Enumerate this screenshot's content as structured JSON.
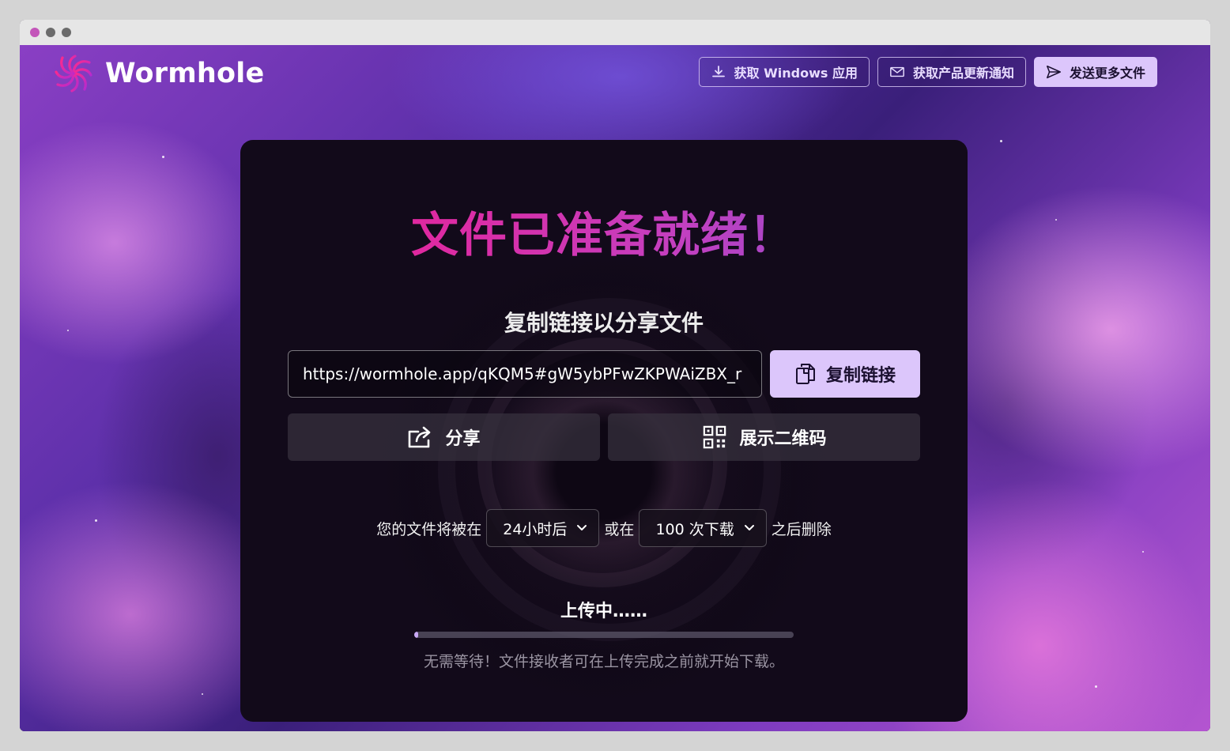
{
  "app": {
    "name": "Wormhole",
    "brand_color": "#f2198a",
    "accent_color": "#dcc6fb"
  },
  "header": {
    "get_windows_app": "获取 Windows 应用",
    "get_updates": "获取产品更新通知",
    "send_more": "发送更多文件",
    "icons": [
      "download-icon",
      "mail-icon",
      "send-icon"
    ]
  },
  "main": {
    "title": "文件已准备就绪！",
    "share_heading": "复制链接以分享文件",
    "link_value": "https://wormhole.app/qKQM5#gW5ybPFwZKPWAiZBX_r",
    "copy_button": "复制链接",
    "share_button": "分享",
    "qr_button": "展示二维码",
    "icons": [
      "copy-icon",
      "share-icon",
      "qr-code-icon",
      "chevron-down-icon"
    ]
  },
  "expiry": {
    "prefix": "您的文件将被在",
    "time_option": "24小时后",
    "middle": "或在",
    "downloads_option": "100 次下载",
    "suffix": "之后删除"
  },
  "upload": {
    "status": "上传中……",
    "progress": 0.01,
    "hint": "无需等待！文件接收者可在上传完成之前就开始下载。"
  }
}
